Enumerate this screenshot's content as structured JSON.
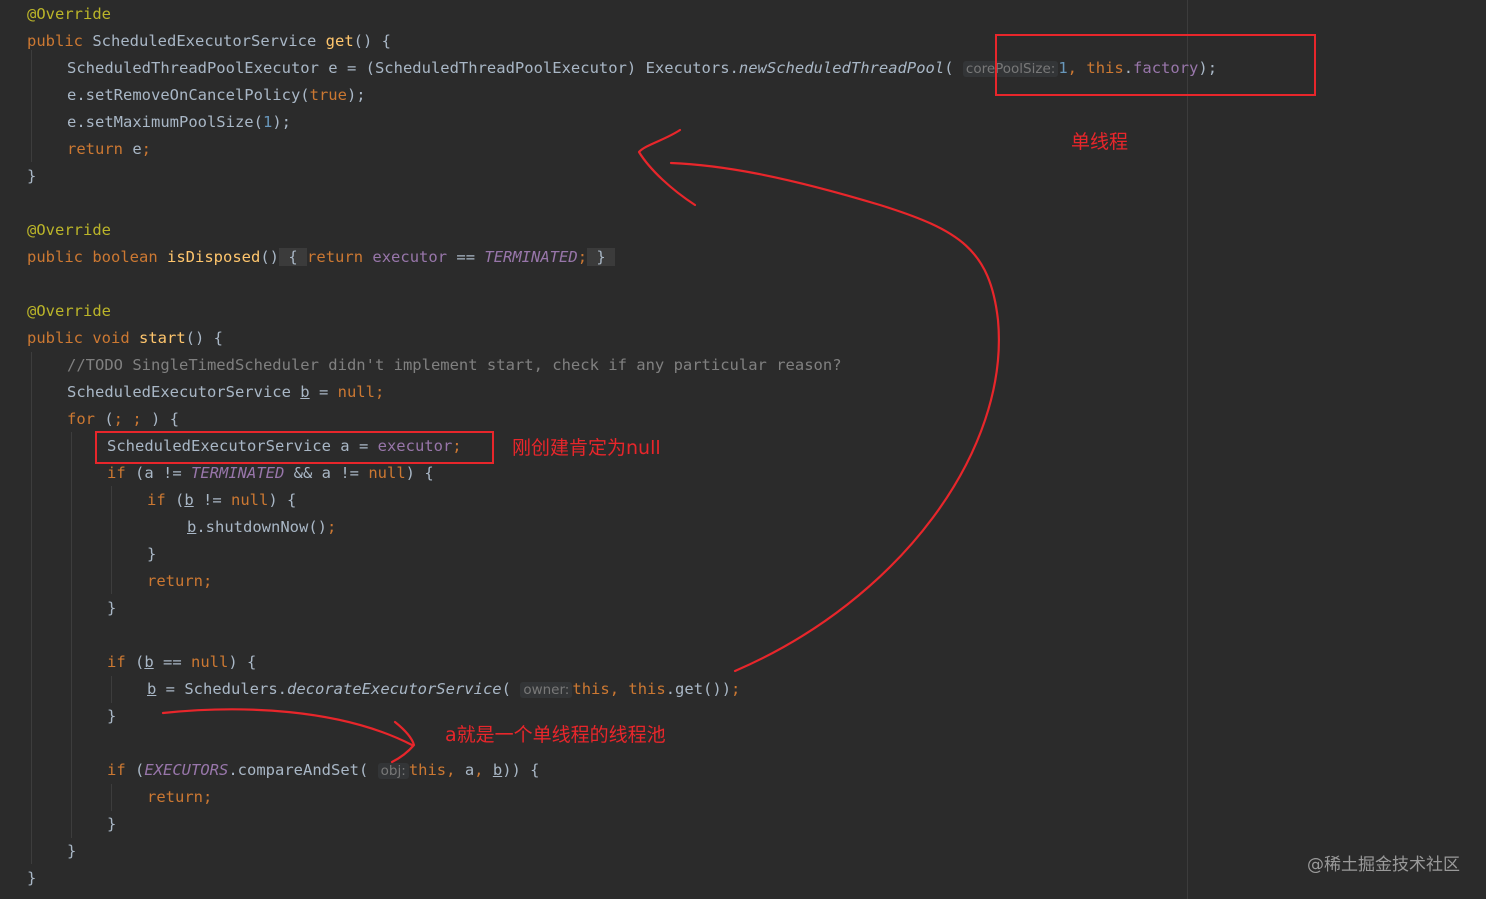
{
  "code": {
    "ann": "@Override",
    "l2_public": "public",
    "l2_type": "ScheduledExecutorService",
    "l2_get": "get",
    "l2_rest": "() {",
    "l3_a": "ScheduledThreadPoolExecutor e = (ScheduledThreadPoolExecutor) Executors.",
    "l3_m": "newScheduledThreadPool",
    "l3_p": "(",
    "l3_hint": "corePoolSize:",
    "l3_num": "1",
    "l3_comma": ",",
    "l3_this": "this",
    "l3_dot": ".",
    "l3_field": "factory",
    "l3_end": ");",
    "l4_a": "e.setRemoveOnCancelPolicy(",
    "l4_true": "true",
    "l4_b": ");",
    "l5_a": "e.setMaximumPoolSize(",
    "l5_num": "1",
    "l5_b": ");",
    "l6_ret": "return",
    "l6_e": " e",
    "l6_semi": ";",
    "close": "}",
    "l10_pb": "public boolean",
    "l10_fn": "isDisposed",
    "l10_par": "()",
    "l10_ob": "{",
    "l10_ret": "return",
    "l10_exec": "executor",
    "l10_eq": " == ",
    "l10_term": "TERMINATED",
    "l10_semi": ";",
    "l10_cb": "}",
    "l13_pv": "public void",
    "l13_fn": "start",
    "l13_rest": "() {",
    "l14_cmt": "//TODO SingleTimedScheduler didn't implement start, check if any particular reason?",
    "l15_a": "ScheduledExecutorService ",
    "l15_b": "b",
    "l15_eq": " = ",
    "l15_null": "null",
    "l15_semi": ";",
    "l16_for": "for",
    "l16_a": " (",
    "l16_s1": ";",
    "l16_s2": ";",
    "l16_b": ") {",
    "l17_a": "ScheduledExecutorService a = ",
    "l17_exec": "executor",
    "l17_semi": ";",
    "l18_if": "if",
    "l18_a": " (a != ",
    "l18_term": "TERMINATED",
    "l18_b": " && a != ",
    "l18_null": "null",
    "l18_c": ") {",
    "l19_if": "if",
    "l19_a": " (",
    "l19_b": "b",
    "l19_ne": " != ",
    "l19_null": "null",
    "l19_c": ") {",
    "l20_b": "b",
    "l20_rest": ".shutdownNow()",
    "l20_semi": ";",
    "l22_ret": "return",
    "l22_semi": ";",
    "l25_if": "if",
    "l25_a": " (",
    "l25_b": "b",
    "l25_eq": " == ",
    "l25_null": "null",
    "l25_c": ") {",
    "l26_b": "b",
    "l26_a": " = Schedulers.",
    "l26_m": "decorateExecutorService",
    "l26_p": "(",
    "l26_hint": "owner:",
    "l26_this1": "this",
    "l26_comma": ",",
    "l26_this2": "this",
    "l26_rest": ".get())",
    "l26_semi": ";",
    "l29_if": "if",
    "l29_a": " (",
    "l29_ex": "EXECUTORS",
    "l29_b": ".compareAndSet(",
    "l29_hint": "obj:",
    "l29_this": "this",
    "l29_comma": ",",
    "l29_aa": " a",
    "l29_comma2": ",",
    "l29_bb": "b",
    "l29_c": ")) {",
    "l30_ret": "return",
    "l30_semi": ";"
  },
  "annotations": {
    "single_thread": "单线程",
    "null_note": "刚创建肯定为null",
    "pool_note": "a就是一个单线程的线程池"
  },
  "watermark": "@稀土掘金技术社区",
  "colors": {
    "background": "#2b2b2b",
    "keyword": "#cc7832",
    "annotation": "#bbb529",
    "method": "#ffc66d",
    "field": "#9876aa",
    "number": "#6897bb",
    "comment": "#808080",
    "text": "#a9b7c6",
    "markup_red": "#e8262b"
  }
}
